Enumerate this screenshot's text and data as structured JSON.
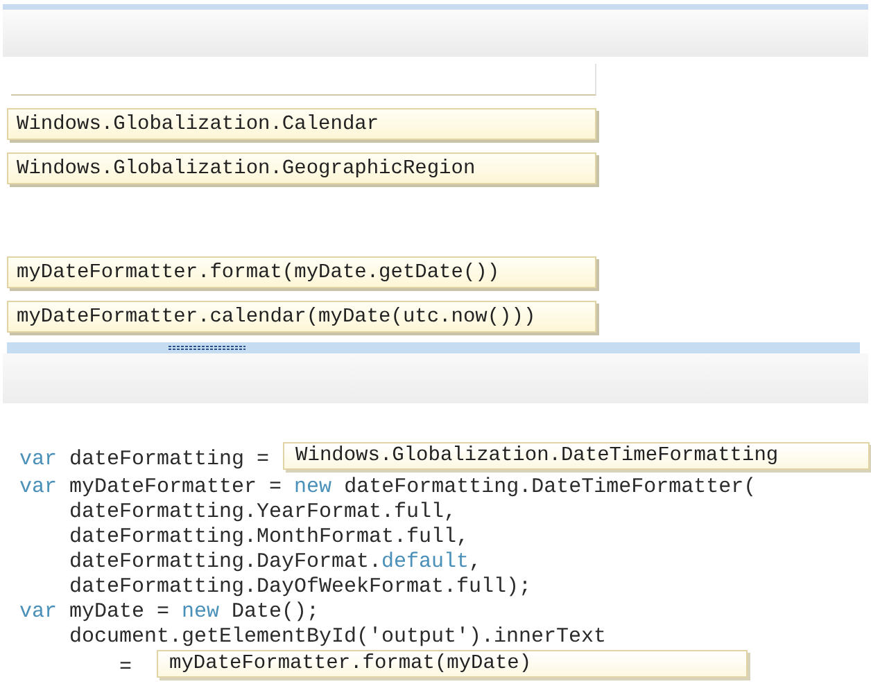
{
  "choices": [
    {
      "kind": "empty"
    },
    {
      "kind": "tile",
      "text": "Windows.Globalization.Calendar"
    },
    {
      "kind": "tile",
      "text": "Windows.Globalization.GeographicRegion"
    },
    {
      "kind": "gap"
    },
    {
      "kind": "tile",
      "text": "myDateFormatter.format(myDate.getDate())"
    },
    {
      "kind": "tile",
      "text": "myDateFormatter.calendar(myDate(utc.now()))"
    }
  ],
  "code": [
    {
      "kind": "statement",
      "segments": [
        {
          "kind": "keyword",
          "text": "var"
        },
        {
          "kind": "plain",
          "text": " dateFormatting ="
        }
      ],
      "slot": "Windows.Globalization.DateTimeFormatting"
    },
    {
      "kind": "statement",
      "segments": [
        {
          "kind": "keyword",
          "text": "var"
        },
        {
          "kind": "plain",
          "text": " myDateFormatter = "
        },
        {
          "kind": "keyword",
          "text": "new"
        },
        {
          "kind": "plain",
          "text": " dateFormatting.DateTimeFormatter("
        }
      ]
    },
    {
      "kind": "continuation",
      "segments": [
        {
          "kind": "plain",
          "text": "dateFormatting.YearFormat.full,"
        }
      ]
    },
    {
      "kind": "continuation",
      "segments": [
        {
          "kind": "plain",
          "text": "dateFormatting.MonthFormat.full,"
        }
      ]
    },
    {
      "kind": "continuation",
      "segments": [
        {
          "kind": "plain",
          "text": "dateFormatting.DayFormat."
        },
        {
          "kind": "keyword",
          "text": "default"
        },
        {
          "kind": "plain",
          "text": ","
        }
      ]
    },
    {
      "kind": "continuation",
      "segments": [
        {
          "kind": "plain",
          "text": "dateFormatting.DayOfWeekFormat.full);"
        }
      ]
    },
    {
      "kind": "statement",
      "segments": [
        {
          "kind": "keyword",
          "text": "var"
        },
        {
          "kind": "plain",
          "text": " myDate = "
        },
        {
          "kind": "keyword",
          "text": "new"
        },
        {
          "kind": "plain",
          "text": " Date();"
        }
      ]
    },
    {
      "kind": "continuation",
      "segments": [
        {
          "kind": "plain",
          "text": "document.getElementById('output').innerText"
        }
      ]
    },
    {
      "kind": "deep",
      "segments": [
        {
          "kind": "plain",
          "text": "="
        }
      ],
      "slot": "myDateFormatter.format(myDate)"
    }
  ]
}
